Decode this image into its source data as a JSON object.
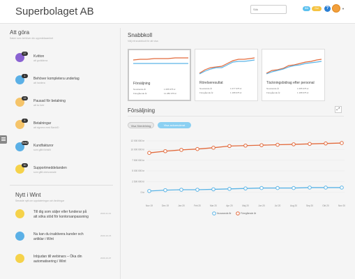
{
  "header": {
    "company": "Superbolaget AB",
    "search_placeholder": "Sök",
    "pill_blue": "Blå",
    "pill_yellow": "Gul",
    "help": "?",
    "caret": "▼"
  },
  "todo": {
    "title": "Att göra",
    "subtitle": "Saker som behöver din uppmärksamhet",
    "items": [
      {
        "label": "Kvitton",
        "sub": "att godkänna",
        "badge": "37",
        "color": "#8a63d2"
      },
      {
        "label": "Behöver kompletera underlag",
        "sub": "att hantera",
        "badge": "1",
        "color": "#5bb0e6"
      },
      {
        "label": "Pausad för betalning",
        "sub": "att ta över",
        "badge": "15",
        "color": "#f5c46a"
      },
      {
        "label": "Betalningar",
        "sub": "att signera med BankID",
        "badge": "8",
        "color": "#f5c46a"
      },
      {
        "label": "Kundfakturor",
        "sub": "som gått förfallit",
        "badge": "8462",
        "color": "#5bb0e6"
      },
      {
        "label": "Supportmeddelanden",
        "sub": "som gått obesvarade",
        "badge": "30",
        "color": "#f5d24a"
      }
    ]
  },
  "news": {
    "title": "Nytt i Wint",
    "subtitle": "Senaste nytt om uppdateringar och ändringar",
    "items": [
      {
        "text": "Till dig som säljer eller funderar på att söka stöd för kontorsanpassning",
        "date": "2020-11-01",
        "color": "#f5d24a"
      },
      {
        "text": "Nu kan du inaktivera kunder och artiklar i Wint",
        "date": "2020-10-15",
        "color": "#5bb0e6"
      },
      {
        "text": "Inbjudan till webinars – Öka din automatisering i Wint",
        "date": "2020-10-07",
        "color": "#f5d24a"
      }
    ]
  },
  "snabbkoll": {
    "title": "Snabbkoll",
    "subtitle": "Välj ett snabbkoll för att visa",
    "cards": [
      {
        "title": "Försäljning",
        "row1": "Nuvarande år",
        "val1": "1 085 975 kr",
        "row2": "Föregående år",
        "val2": "11 280 975 kr"
      },
      {
        "title": "Rörelseresultat",
        "row1": "Nuvarande år",
        "val1": "1 077 975 kr",
        "row2": "Föregående år",
        "val2": "1 188 975 kr"
      },
      {
        "title": "Täckningsbidrag efter personal",
        "row1": "Nuvarande år",
        "val1": "1 085 975 kr",
        "row2": "Föregående år",
        "val2": "1 188 975 kr"
      }
    ]
  },
  "sales": {
    "title": "Försäljning",
    "expand": "⤢",
    "btn_a": "Visa föredelning",
    "btn_b": "Visa ackumulerat"
  },
  "chart_data": {
    "type": "line",
    "title": "Försäljning",
    "categories": [
      "Nov 19",
      "Dec 19",
      "Jan 20",
      "Feb 20",
      "Mar 20",
      "Apr 20",
      "Maj 20",
      "Jun 20",
      "Jul 20",
      "Aug 20",
      "Sep 20",
      "Okt 20",
      "Nov 20"
    ],
    "ylim": [
      -2000000,
      12000000
    ],
    "yticks": [
      0,
      2500000,
      5000000,
      7500000,
      10000000,
      12000000
    ],
    "ytick_labels": [
      "0 kr",
      "2 500 000 kr",
      "5 000 000 kr",
      "7 500 000 kr",
      "10 000 000 kr",
      "12 000 000 kr"
    ],
    "series": [
      {
        "name": "Nuvarande år",
        "color": "#5ab4e6",
        "values": [
          300000,
          500000,
          600000,
          600000,
          700000,
          800000,
          900000,
          1000000,
          1000000,
          1000000,
          1100000,
          1100000,
          1100000
        ]
      },
      {
        "name": "Föregående år",
        "color": "#e26a3c",
        "values": [
          9200000,
          9600000,
          9900000,
          10100000,
          10400000,
          10800000,
          10900000,
          11000000,
          11100000,
          11200000,
          11300000,
          11400000,
          11500000
        ]
      }
    ],
    "legend": "bottom"
  }
}
